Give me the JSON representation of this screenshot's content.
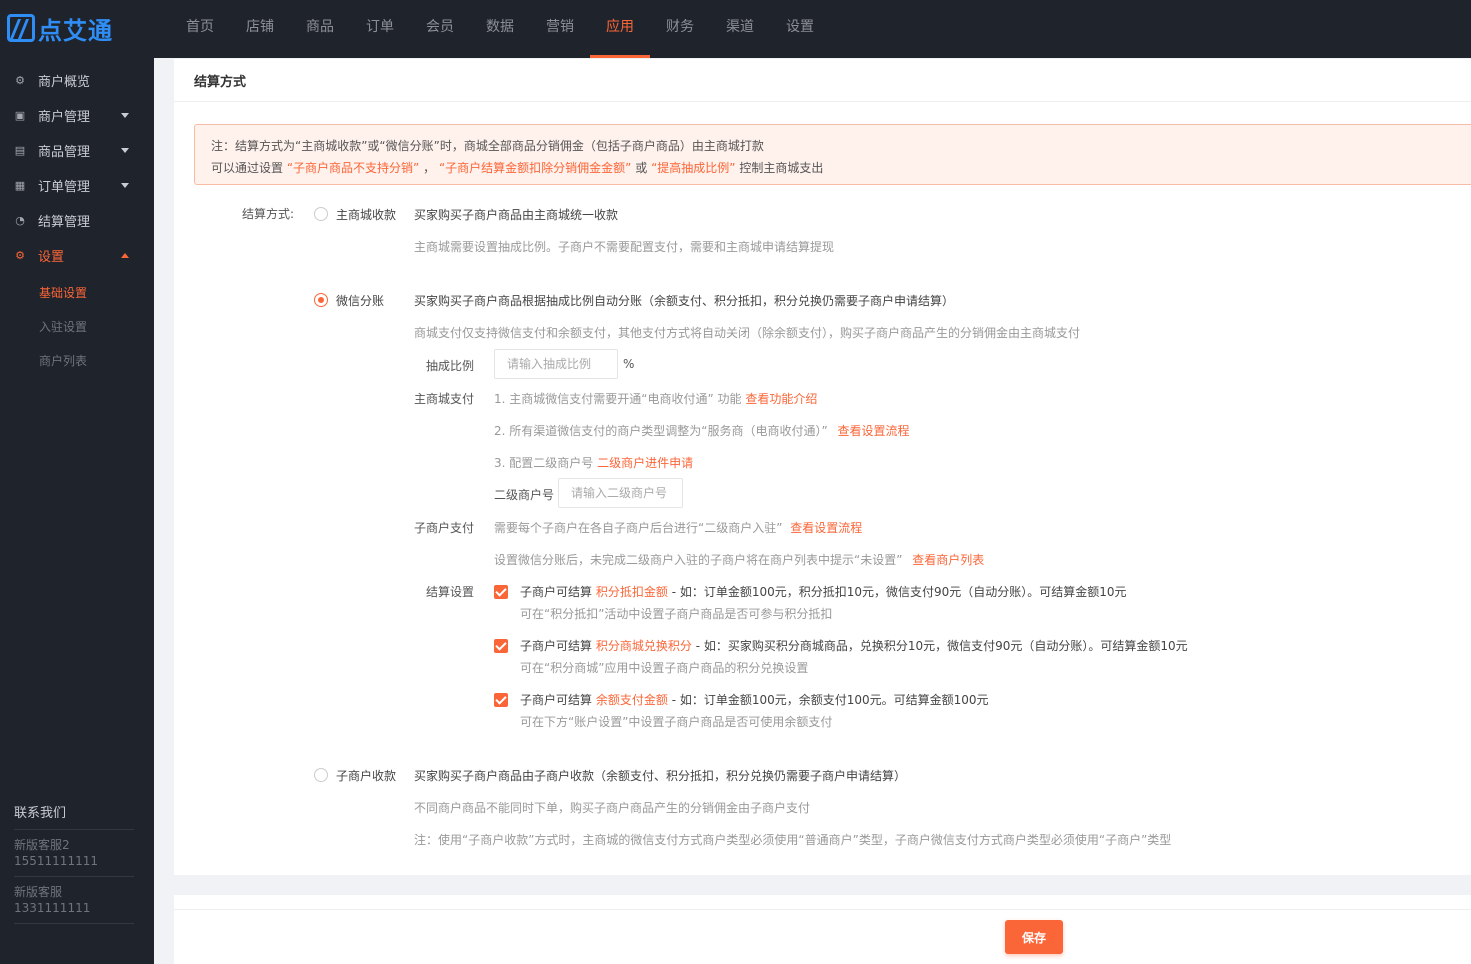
{
  "brand": {
    "logo_text": "点艾通",
    "accent": "#fb6638",
    "logo_color": "#2f8ef5"
  },
  "topnav": [
    {
      "label": "首页"
    },
    {
      "label": "店铺"
    },
    {
      "label": "商品"
    },
    {
      "label": "订单"
    },
    {
      "label": "会员"
    },
    {
      "label": "数据"
    },
    {
      "label": "营销"
    },
    {
      "label": "应用",
      "active": true
    },
    {
      "label": "财务"
    },
    {
      "label": "渠道"
    },
    {
      "label": "设置"
    }
  ],
  "sidebar": {
    "items": [
      {
        "label": "商户概览",
        "icon": "gear-icon"
      },
      {
        "label": "商户管理",
        "icon": "store-icon"
      },
      {
        "label": "商品管理",
        "icon": "goods-icon"
      },
      {
        "label": "订单管理",
        "icon": "order-icon"
      },
      {
        "label": "结算管理",
        "icon": "settle-icon"
      },
      {
        "label": "设置",
        "icon": "settings-icon",
        "active": true
      }
    ],
    "subitems": [
      {
        "label": "基础设置",
        "active": true
      },
      {
        "label": "入驻设置"
      },
      {
        "label": "商户列表"
      }
    ],
    "contact": {
      "title": "联系我们",
      "entries": [
        {
          "name": "新版客服2",
          "phone": "15511111111"
        },
        {
          "name": "新版客服",
          "phone": "1331111111"
        }
      ]
    }
  },
  "panel": {
    "title": "结算方式",
    "notice": {
      "line1": "注：结算方式为“主商城收款”或“微信分账”时，商城全部商品分销佣金（包括子商户商品）由主商城打款",
      "line2_prefix": "可以通过设置",
      "link1": "“子商户商品不支持分销”",
      "sep1": "，",
      "link2": "“子商户结算金额扣除分销佣金金额”",
      "sep2": "或",
      "link3": "“提高抽成比例”",
      "line2_suffix": "控制主商城支出"
    },
    "settle_label": "结算方式:",
    "option1": {
      "label": "主商城收款",
      "title": "买家购买子商户商品由主商城统一收款",
      "desc": "主商城需要设置抽成比例。子商户不需要配置支付，需要和主商城申请结算提现"
    },
    "option2": {
      "label": "微信分账",
      "title": "买家购买子商户商品根据抽成比例自动分账（余额支付、积分抵扣，积分兑换仍需要子商户申请结算）",
      "desc": "商城支付仅支持微信支付和余额支付，其他支付方式将自动关闭（除余额支付），购买子商户商品产生的分销佣金由主商城支付",
      "rate_label": "抽成比例",
      "rate_placeholder": "请输入抽成比例",
      "rate_unit": "%",
      "main_pay_label": "主商城支付",
      "step1": "1. 主商城微信支付需要开通“电商收付通” 功能",
      "step1_link": "查看功能介绍",
      "step2": "2. 所有渠道微信支付的商户类型调整为“服务商（电商收付通）”",
      "step2_link": "查看设置流程",
      "step3": "3. 配置二级商户号",
      "step3_link": "二级商户进件申请",
      "sub_merchant_label": "二级商户号",
      "sub_merchant_placeholder": "请输入二级商户号",
      "sub_pay_label": "子商户支付",
      "sub_pay_text": "需要每个子商户在各自子商户后台进行“二级商户入驻”",
      "sub_pay_link": "查看设置流程",
      "sub_pay_note": "设置微信分账后，未完成二级商户入驻的子商户将在商户列表中提示“未设置”",
      "sub_pay_note_link": "查看商户列表",
      "settle_setting_label": "结算设置",
      "checks": [
        {
          "prefix": "子商户可结算",
          "link": "积分抵扣金额",
          "suffix": "- 如：订单金额100元，积分抵扣10元，微信支付90元（自动分账）。可结算金额10元",
          "desc": "可在“积分抵扣”活动中设置子商户商品是否可参与积分抵扣"
        },
        {
          "prefix": "子商户可结算",
          "link": "积分商城兑换积分",
          "suffix": "- 如：买家购买积分商城商品，兑换积分10元，微信支付90元（自动分账）。可结算金额10元",
          "desc": "可在“积分商城”应用中设置子商户商品的积分兑换设置"
        },
        {
          "prefix": "子商户可结算",
          "link": "余额支付金额",
          "suffix": "- 如：订单金额100元，余额支付100元。可结算金额100元",
          "desc": "可在下方“账户设置”中设置子商户商品是否可使用余额支付"
        }
      ]
    },
    "option3": {
      "label": "子商户收款",
      "title": "买家购买子商户商品由子商户收款（余额支付、积分抵扣，积分兑换仍需要子商户申请结算）",
      "desc": "不同商户商品不能同时下单，购买子商户商品产生的分销佣金由子商户支付",
      "note": "注：使用“子商户收款”方式时，主商城的微信支付方式商户类型必须使用“普通商户”类型，子商户微信支付方式商户类型必须使用“子商户”类型"
    }
  },
  "footer": {
    "save_label": "保存"
  }
}
